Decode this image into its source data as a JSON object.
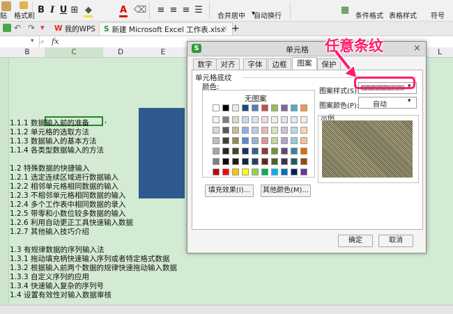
{
  "ribbon": {
    "format_painter": "格式刷",
    "merge_center": "合并居中",
    "wrap_text": "自动换行",
    "conditional_format": "条件格式",
    "table_style": "表格样式",
    "symbol": "符号",
    "bold": "B",
    "italic": "I",
    "underline": "U",
    "font_color_glyph": "A"
  },
  "doc_tabs": {
    "my_wps": "我的WPS",
    "file": "新建 Microsoft Excel 工作表.xlsx",
    "add": "+"
  },
  "formula_bar": {
    "fx": "fx"
  },
  "columns": [
    "B",
    "C",
    "D",
    "E",
    "L"
  ],
  "sheet_lines": [
    "1.1.1 数据输入前的准备",
    "1.1.2 单元格的选取方法",
    "1.1.3 数据输入的基本方法",
    "1.1.4 各类型数据输入的方法",
    "1.2 特殊数据的快捷输入",
    "1.2.1 选定连续区域进行数据输入",
    "1.2.2 相邻单元格相同数据的输入",
    "1.2.3 不相邻单元格相同数据的输入",
    "1.2.4 多个工作表中相同数据的录入",
    "1.2.5 带零和小数位较多数据的输入",
    "1.2.6 利用自动更正工具快速输入数据",
    "1.2.7 其他输入技巧介绍",
    "1.3 有规律数据的序列输入法",
    "1.3.1 拖动填充柄快速输入序列或者特定格式数据",
    "1.3.2 根据输入前两个数据的规律快速拖动输入数据",
    "1.3.3 自定义序列的应用",
    "1.3.4 快速输入复杂的序列号",
    "1.4 设置有效性对输入数据审核"
  ],
  "dialog": {
    "title": "单元格",
    "tabs": [
      "数字",
      "对齐",
      "字体",
      "边框",
      "图案",
      "保护"
    ],
    "section": "单元格底纹",
    "color_label": "颜色:",
    "no_pattern": "无图案",
    "pattern_style_label": "图案样式(S):",
    "pattern_color_label": "图案颜色(P):",
    "pattern_color_value": "自动",
    "sample_label": "示例",
    "fill_effects": "填充效果(I)...",
    "more_colors": "其他颜色(M)...",
    "ok": "确定",
    "cancel": "取消"
  },
  "annotation": "任意条纹",
  "colors": {
    "accent_pink": "#ff1a6e",
    "sheet_green": "#d3ead3",
    "dark_blue_fill": "#2e5a8e",
    "sample_pattern": "#4a4632"
  }
}
